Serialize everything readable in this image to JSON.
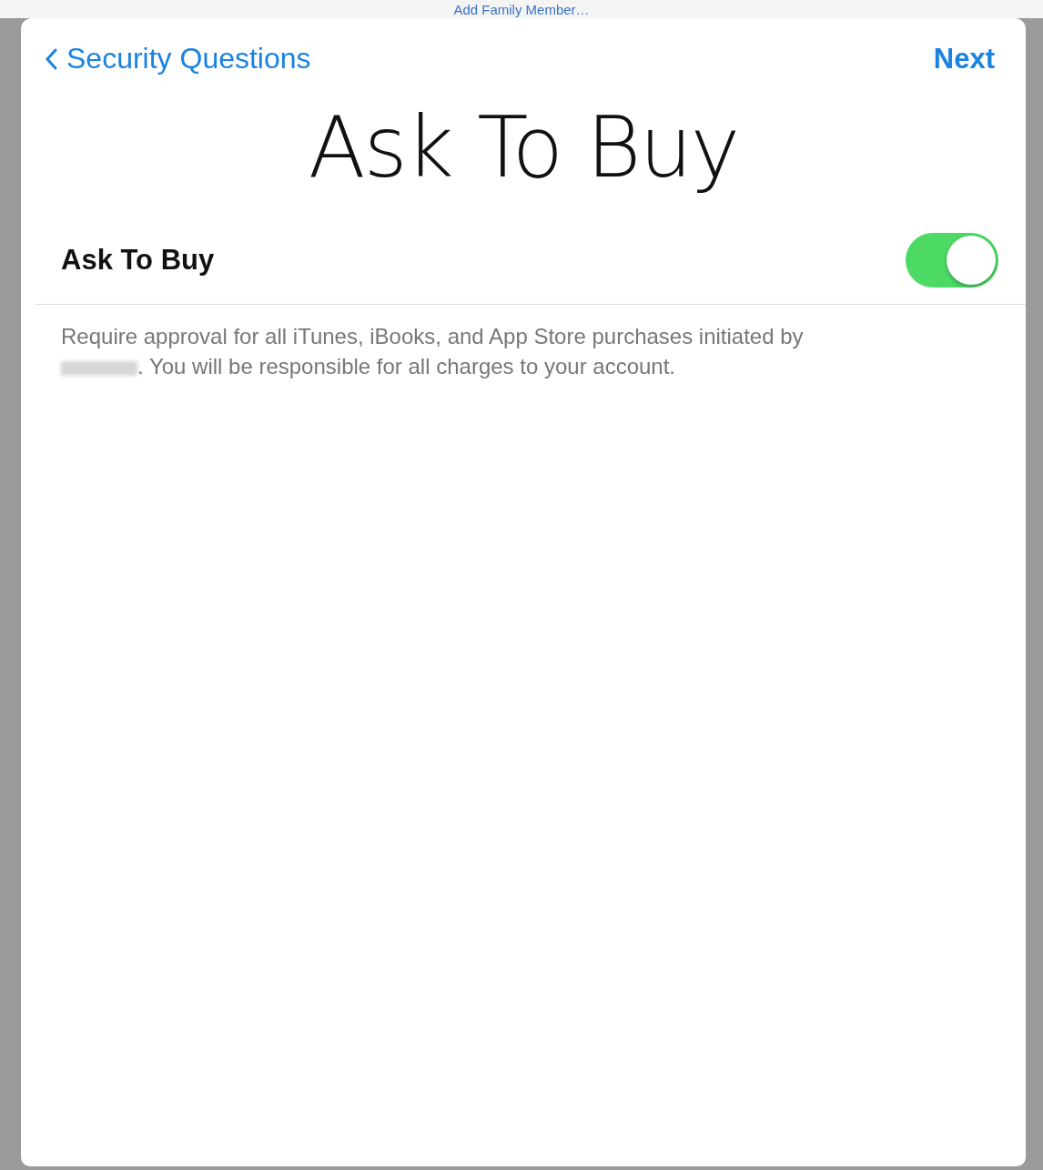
{
  "background": {
    "link": "Add Family Member…"
  },
  "nav": {
    "back": "Security Questions",
    "next": "Next"
  },
  "title": "Ask To Buy",
  "setting": {
    "label": "Ask To Buy",
    "on": true
  },
  "description": {
    "before": "Require approval for all iTunes, iBooks, and App Store purchases initiated by",
    "after": ". You will be responsible for all charges to your account."
  }
}
